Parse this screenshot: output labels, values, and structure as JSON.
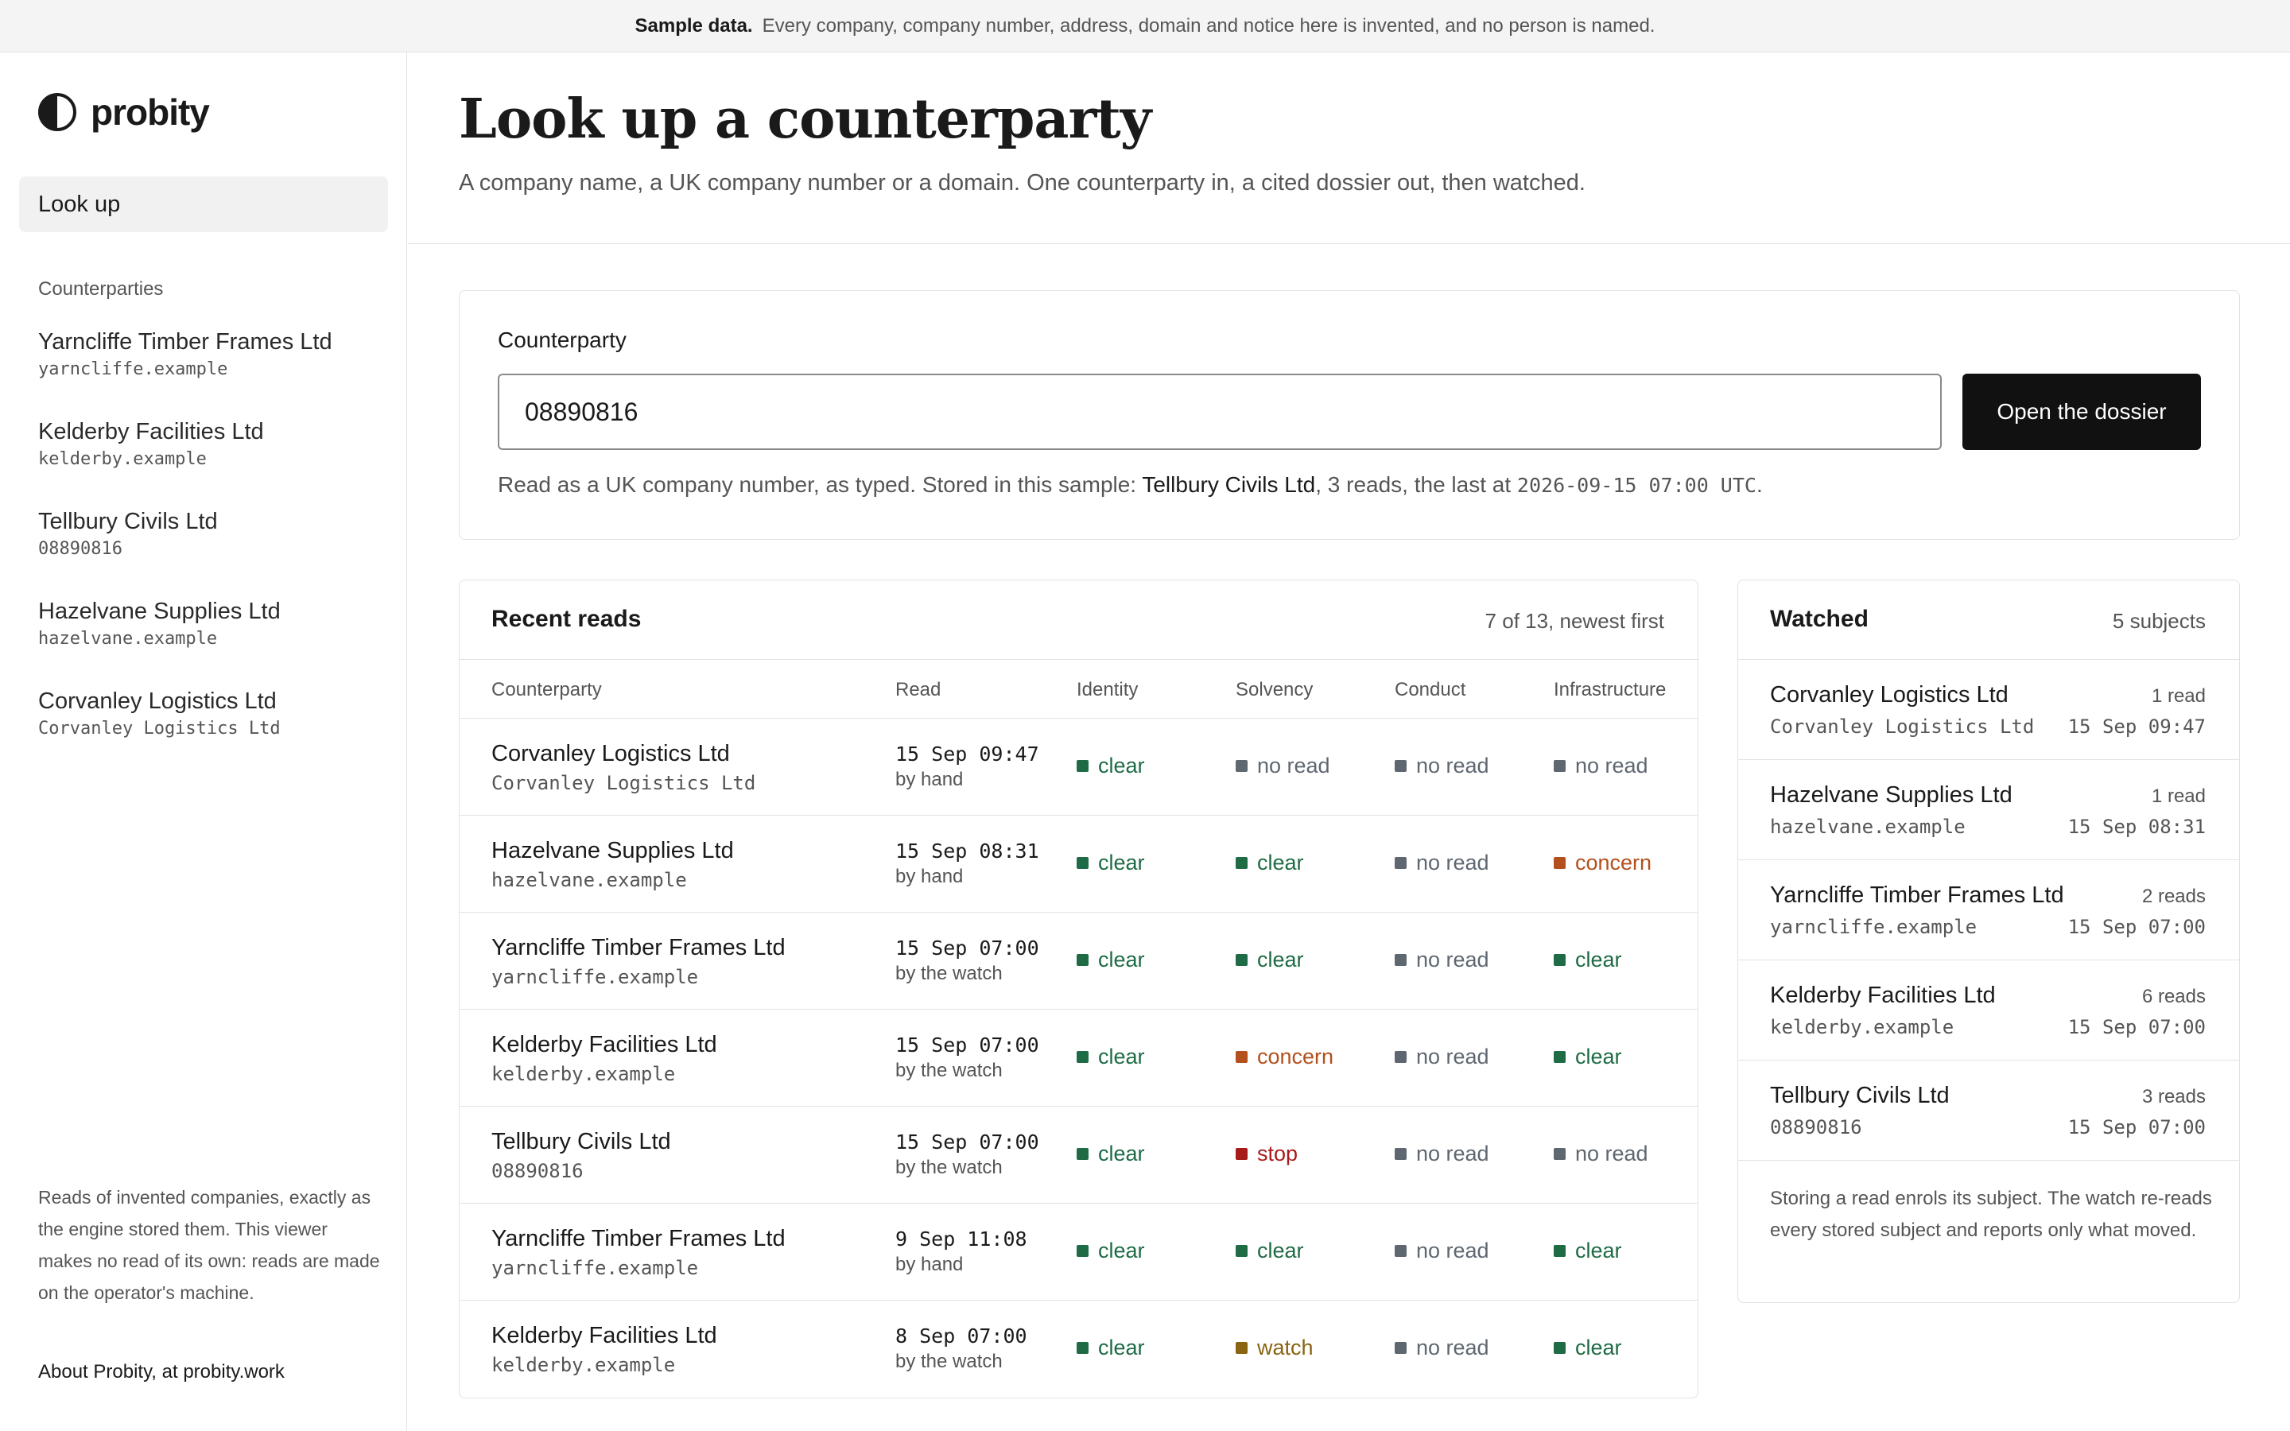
{
  "banner": {
    "label": "Sample data.",
    "text": "Every company, company number, address, domain and notice here is invented, and no person is named."
  },
  "app": {
    "name": "probity",
    "logo_icon": "half-filled-circle-icon"
  },
  "sidebar": {
    "nav_lookup": "Look up",
    "section_label": "Counterparties",
    "items": [
      {
        "name": "Yarncliffe Timber Frames Ltd",
        "sub": "yarncliffe.example"
      },
      {
        "name": "Kelderby Facilities Ltd",
        "sub": "kelderby.example"
      },
      {
        "name": "Tellbury Civils Ltd",
        "sub": "08890816"
      },
      {
        "name": "Hazelvane Supplies Ltd",
        "sub": "hazelvane.example"
      },
      {
        "name": "Corvanley Logistics Ltd",
        "sub": "Corvanley Logistics Ltd"
      }
    ],
    "footer": "Reads of invented companies, exactly as the engine stored them. This viewer makes no read of its own: reads are made on the operator's machine.",
    "about": "About Probity, at probity.work"
  },
  "header": {
    "title": "Look up a counterparty",
    "subtitle": "A company name, a UK company number or a domain. One counterparty in, a cited dossier out, then watched."
  },
  "lookup": {
    "label": "Counterparty",
    "value": "08890816",
    "button": "Open the dossier",
    "note_prefix": "Read as a UK company number, as typed. Stored in this sample: ",
    "note_company": "Tellbury Civils Ltd",
    "note_middle": ", 3 reads, the last at ",
    "note_time": "2026-09-15 07:00 UTC",
    "note_suffix": "."
  },
  "recent": {
    "title": "Recent reads",
    "count": "7 of 13, newest first",
    "columns": [
      "Counterparty",
      "Read",
      "Identity",
      "Solvency",
      "Conduct",
      "Infrastructure"
    ],
    "rows": [
      {
        "name": "Corvanley Logistics Ltd",
        "sub": "Corvanley Logistics Ltd",
        "time": "15 Sep 09:47",
        "by": "by hand",
        "identity": "clear",
        "solvency": "no read",
        "conduct": "no read",
        "infrastructure": "no read"
      },
      {
        "name": "Hazelvane Supplies Ltd",
        "sub": "hazelvane.example",
        "time": "15 Sep 08:31",
        "by": "by hand",
        "identity": "clear",
        "solvency": "clear",
        "conduct": "no read",
        "infrastructure": "concern"
      },
      {
        "name": "Yarncliffe Timber Frames Ltd",
        "sub": "yarncliffe.example",
        "time": "15 Sep 07:00",
        "by": "by the watch",
        "identity": "clear",
        "solvency": "clear",
        "conduct": "no read",
        "infrastructure": "clear"
      },
      {
        "name": "Kelderby Facilities Ltd",
        "sub": "kelderby.example",
        "time": "15 Sep 07:00",
        "by": "by the watch",
        "identity": "clear",
        "solvency": "concern",
        "conduct": "no read",
        "infrastructure": "clear"
      },
      {
        "name": "Tellbury Civils Ltd",
        "sub": "08890816",
        "time": "15 Sep 07:00",
        "by": "by the watch",
        "identity": "clear",
        "solvency": "stop",
        "conduct": "no read",
        "infrastructure": "no read"
      },
      {
        "name": "Yarncliffe Timber Frames Ltd",
        "sub": "yarncliffe.example",
        "time": "9 Sep 11:08",
        "by": "by hand",
        "identity": "clear",
        "solvency": "clear",
        "conduct": "no read",
        "infrastructure": "clear"
      },
      {
        "name": "Kelderby Facilities Ltd",
        "sub": "kelderby.example",
        "time": "8 Sep 07:00",
        "by": "by the watch",
        "identity": "clear",
        "solvency": "watch",
        "conduct": "no read",
        "infrastructure": "clear"
      }
    ]
  },
  "status_colors": {
    "clear": "#1e6b45",
    "no read": "#5f6770",
    "concern": "#b3501d",
    "stop": "#a81b1b",
    "watch": "#8a6410"
  },
  "watched": {
    "title": "Watched",
    "count": "5 subjects",
    "items": [
      {
        "name": "Corvanley Logistics Ltd",
        "reads": "1 read",
        "sub": "Corvanley Logistics Ltd",
        "time": "15 Sep 09:47"
      },
      {
        "name": "Hazelvane Supplies Ltd",
        "reads": "1 read",
        "sub": "hazelvane.example",
        "time": "15 Sep 08:31"
      },
      {
        "name": "Yarncliffe Timber Frames Ltd",
        "reads": "2 reads",
        "sub": "yarncliffe.example",
        "time": "15 Sep 07:00"
      },
      {
        "name": "Kelderby Facilities Ltd",
        "reads": "6 reads",
        "sub": "kelderby.example",
        "time": "15 Sep 07:00"
      },
      {
        "name": "Tellbury Civils Ltd",
        "reads": "3 reads",
        "sub": "08890816",
        "time": "15 Sep 07:00"
      }
    ],
    "footer": "Storing a read enrols its subject. The watch re-reads every stored subject and reports only what moved."
  }
}
